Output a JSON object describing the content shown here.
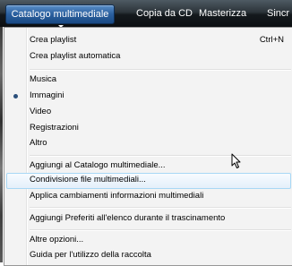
{
  "tabs": [
    {
      "label": "Catalogo multimediale"
    },
    {
      "label": "Copia da CD"
    },
    {
      "label": "Masterizza"
    },
    {
      "label": "Sincr"
    }
  ],
  "menu": {
    "items": [
      {
        "label": "Crea playlist",
        "shortcut": "Ctrl+N"
      },
      {
        "label": "Crea playlist automatica"
      },
      {
        "label": "Musica"
      },
      {
        "label": "Immagini",
        "selected": true
      },
      {
        "label": "Video"
      },
      {
        "label": "Registrazioni"
      },
      {
        "label": "Altro"
      },
      {
        "label": "Aggiungi al Catalogo multimediale..."
      },
      {
        "label": "Condivisione file multimediali...",
        "hovered": true
      },
      {
        "label": "Applica cambiamenti informazioni multimediali"
      },
      {
        "label": "Aggiungi Preferiti all'elenco durante il trascinamento"
      },
      {
        "label": "Altre opzioni..."
      },
      {
        "label": "Guida per l'utilizzo della raccolta"
      }
    ]
  },
  "colors": {
    "highlight_border": "#a8d8f5",
    "active_tab": "#2a5f9e"
  }
}
